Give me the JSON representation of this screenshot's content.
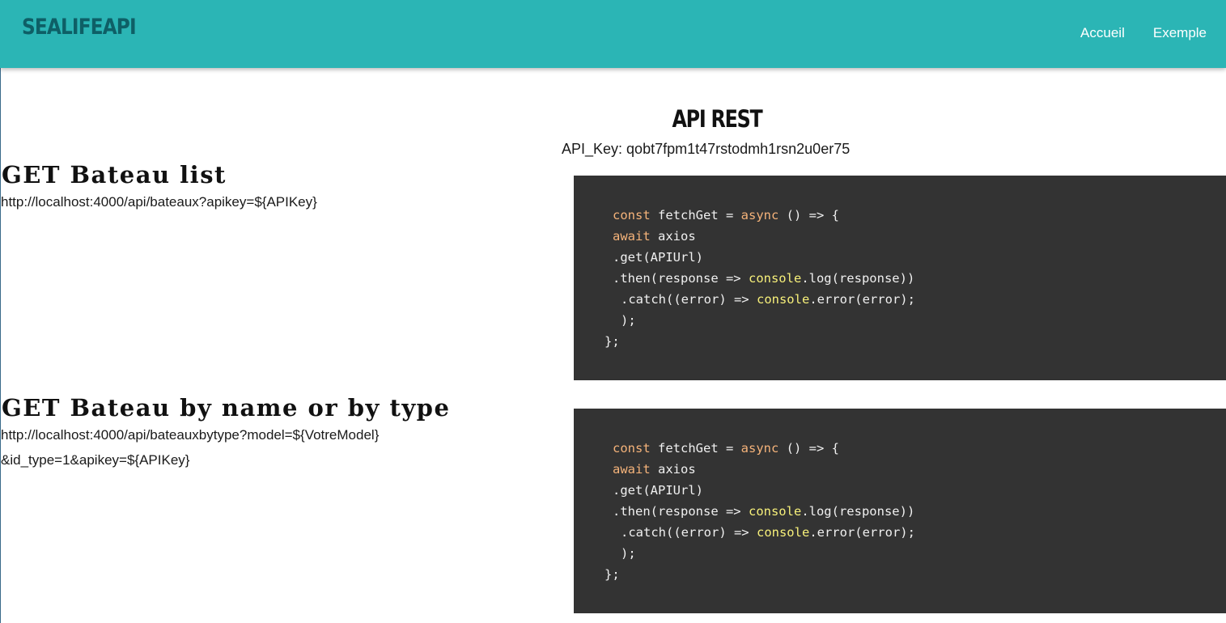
{
  "navbar": {
    "brand": "SEALIFEAPI",
    "links": [
      "Accueil",
      "Exemple"
    ]
  },
  "page": {
    "title": "API REST",
    "api_key": "API_Key: qobt7fpm1t47rstodmh1rsn2u0er75"
  },
  "sections": [
    {
      "title": "GET Bateau list",
      "endpoint_lines": [
        "http://localhost:4000/api/bateaux?apikey=${APIKey}"
      ],
      "code": {
        "kw_const": "const",
        "line1_mid": " fetchGet = ",
        "kw_async": "async",
        "line1_end": " () => {",
        "kw_await": "await",
        "line2_end": " axios",
        "line3": ".get(APIUrl)",
        "line4_start": ".then(response => ",
        "console1": "console",
        "line4_end": ".log(response))",
        "line5_start": ".catch((error) => ",
        "console2": "console",
        "line5_end": ".error(error);",
        "line6": ");",
        "line7": "};"
      }
    },
    {
      "title": "GET Bateau by name or by type",
      "endpoint_lines": [
        "http://localhost:4000/api/bateauxbytype?model=${VotreModel}",
        "&id_type=1&apikey=${APIKey}"
      ],
      "code": {
        "kw_const": "const",
        "line1_mid": " fetchGet = ",
        "kw_async": "async",
        "line1_end": " () => {",
        "kw_await": "await",
        "line2_end": " axios",
        "line3": ".get(APIUrl)",
        "line4_start": ".then(response => ",
        "console1": "console",
        "line4_end": ".log(response))",
        "line5_start": ".catch((error) => ",
        "console2": "console",
        "line5_end": ".error(error);",
        "line6": ");",
        "line7": "};"
      }
    }
  ],
  "colors": {
    "navbar_bg": "#2bb5b5",
    "brand": "#0e5f66",
    "code_bg": "#333333",
    "keyword": "#f5b37a",
    "builtin": "#f7f07a"
  }
}
